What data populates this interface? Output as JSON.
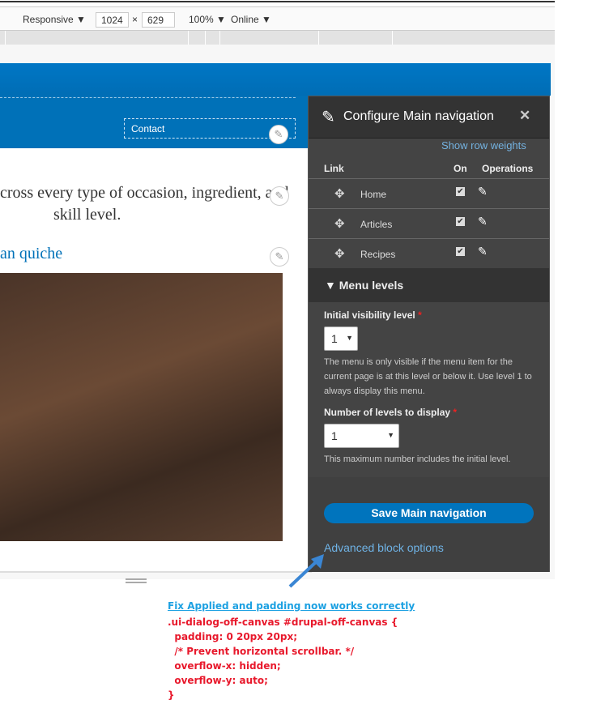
{
  "devtools": {
    "device": "Responsive",
    "width": "1024",
    "times": "×",
    "height": "629",
    "zoom": "100%",
    "network": "Online",
    "caret": "▼"
  },
  "site": {
    "contact_link": "Contact",
    "intro_line1": "cross every type of occasion, ingredient, and",
    "intro_line2": "skill level.",
    "article_title": "an quiche",
    "edit_icon": "✎"
  },
  "panel": {
    "title": "Configure Main navigation",
    "close": "✕",
    "show_row_weights": "Show row weights",
    "columns": {
      "link": "Link",
      "on": "On",
      "operations": "Operations"
    },
    "rows": [
      {
        "label": "Home",
        "on": true
      },
      {
        "label": "Articles",
        "on": true
      },
      {
        "label": "Recipes",
        "on": true
      }
    ],
    "menu_levels": "Menu levels",
    "initial_label": "Initial visibility level",
    "initial_value": "1",
    "initial_help": "The menu is only visible if the menu item for the current page is at this level or below it. Use level 1 to always display this menu.",
    "levels_label": "Number of levels to display",
    "levels_value": "1",
    "levels_help": "This maximum number includes the initial level.",
    "required": "*",
    "save": "Save Main navigation",
    "advanced": "Advanced block options"
  },
  "annotation": {
    "title": "Fix Applied and padding now works correctly",
    "code": [
      ".ui-dialog-off-canvas #drupal-off-canvas {",
      "  padding: 0 20px 20px;",
      "  /* Prevent horizontal scrollbar. */",
      "  overflow-x: hidden;",
      "  overflow-y: auto;",
      "}"
    ]
  },
  "colors": {
    "brand_blue": "#0071b8",
    "panel_bg": "#444444",
    "annotation_red": "#e8192c",
    "annotation_blue": "#1da1e2"
  }
}
